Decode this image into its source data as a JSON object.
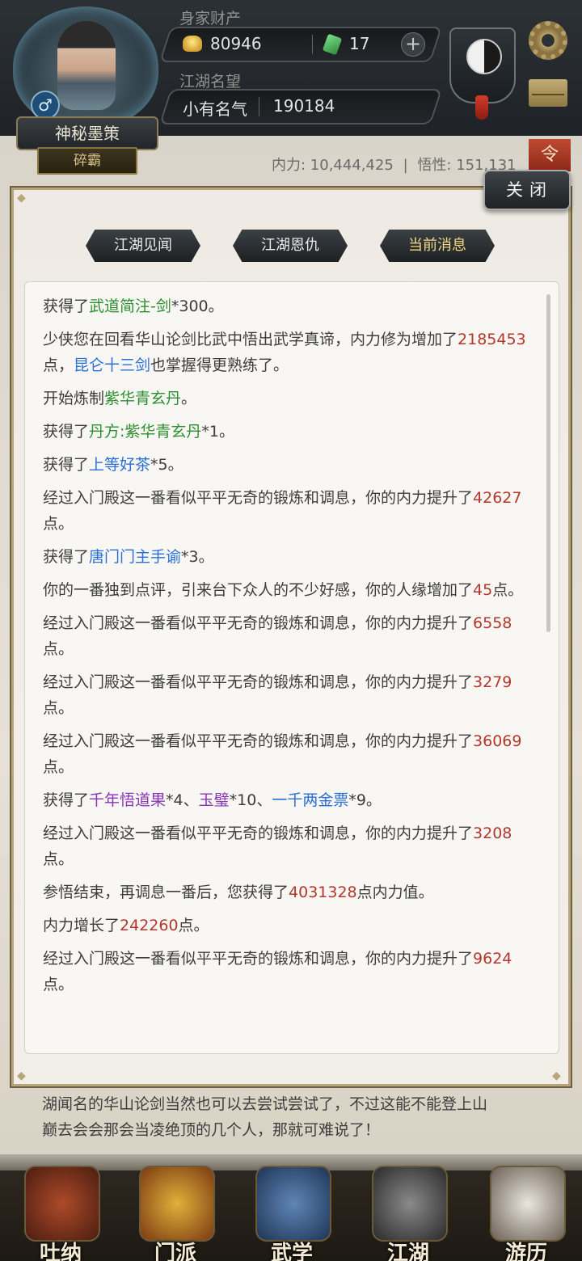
{
  "header": {
    "player_name": "神秘墨策",
    "rank": "碎霸",
    "gender_symbol": "♂",
    "wealth_label": "身家财产",
    "gold": "80946",
    "jade": "17",
    "plus_symbol": "+",
    "fame_label": "江湖名望",
    "fame_title": "小有名气",
    "fame_value": "190184",
    "taiji_sub": "-"
  },
  "stats": {
    "neili": "内力: 10,444,425",
    "divider": "|",
    "wuxing": "悟性: 151,131"
  },
  "red_tab": "令",
  "dialog": {
    "close_label": "关闭",
    "tabs": [
      "江湖见闻",
      "江湖恩仇",
      "当前消息"
    ],
    "active_tab": 2
  },
  "messages": [
    [
      {
        "t": "获得了"
      },
      {
        "t": "武道简注-剑",
        "c": "green"
      },
      {
        "t": "*300。"
      }
    ],
    [
      {
        "t": "少侠您在回看华山论剑比武中悟出武学真谛，内力修为增加了"
      },
      {
        "t": "2185453",
        "c": "red"
      },
      {
        "t": "点，"
      },
      {
        "t": "昆仑十三剑",
        "c": "blue"
      },
      {
        "t": "也掌握得更熟练了。"
      }
    ],
    [
      {
        "t": "开始炼制"
      },
      {
        "t": "紫华青玄丹",
        "c": "green"
      },
      {
        "t": "。"
      }
    ],
    [
      {
        "t": "获得了"
      },
      {
        "t": "丹方:紫华青玄丹",
        "c": "green"
      },
      {
        "t": "*1。"
      }
    ],
    [
      {
        "t": "获得了"
      },
      {
        "t": "上等好茶",
        "c": "blue"
      },
      {
        "t": "*5。"
      }
    ],
    [
      {
        "t": "经过入门殿这一番看似平平无奇的锻炼和调息，你的内力提升了"
      },
      {
        "t": "42627",
        "c": "red"
      },
      {
        "t": "点。"
      }
    ],
    [
      {
        "t": "获得了"
      },
      {
        "t": "唐门门主手谕",
        "c": "blue"
      },
      {
        "t": "*3。"
      }
    ],
    [
      {
        "t": "你的一番独到点评，引来台下众人的不少好感，你的人缘增加了"
      },
      {
        "t": "45",
        "c": "red"
      },
      {
        "t": "点。"
      }
    ],
    [
      {
        "t": "经过入门殿这一番看似平平无奇的锻炼和调息，你的内力提升了"
      },
      {
        "t": "6558",
        "c": "red"
      },
      {
        "t": "点。"
      }
    ],
    [
      {
        "t": "经过入门殿这一番看似平平无奇的锻炼和调息，你的内力提升了"
      },
      {
        "t": "3279",
        "c": "red"
      },
      {
        "t": "点。"
      }
    ],
    [
      {
        "t": "经过入门殿这一番看似平平无奇的锻炼和调息，你的内力提升了"
      },
      {
        "t": "36069",
        "c": "red"
      },
      {
        "t": "点。"
      }
    ],
    [
      {
        "t": "获得了"
      },
      {
        "t": "千年悟道果",
        "c": "purple"
      },
      {
        "t": "*4、"
      },
      {
        "t": "玉璧",
        "c": "purple"
      },
      {
        "t": "*10、"
      },
      {
        "t": "一千两金票",
        "c": "blue"
      },
      {
        "t": "*9。"
      }
    ],
    [
      {
        "t": "经过入门殿这一番看似平平无奇的锻炼和调息，你的内力提升了"
      },
      {
        "t": "3208",
        "c": "red"
      },
      {
        "t": "点。"
      }
    ],
    [
      {
        "t": "参悟结束，再调息一番后，您获得了"
      },
      {
        "t": "4031328",
        "c": "red"
      },
      {
        "t": "点内力值。"
      }
    ],
    [
      {
        "t": "内力增长了"
      },
      {
        "t": "242260",
        "c": "red"
      },
      {
        "t": "点。"
      }
    ],
    [
      {
        "t": "经过入门殿这一番看似平平无奇的锻炼和调息，你的内力提升了"
      },
      {
        "t": "9624",
        "c": "red"
      },
      {
        "t": "点。"
      }
    ]
  ],
  "story": {
    "line1": "湖闻名的华山论剑当然也可以去尝试尝试了，不过这能不能登上山",
    "line2": "巅去会会那会当凌绝顶的几个人，那就可难说了！"
  },
  "nav": {
    "items": [
      "吐纳",
      "门派",
      "武学",
      "江湖",
      "游历"
    ]
  }
}
